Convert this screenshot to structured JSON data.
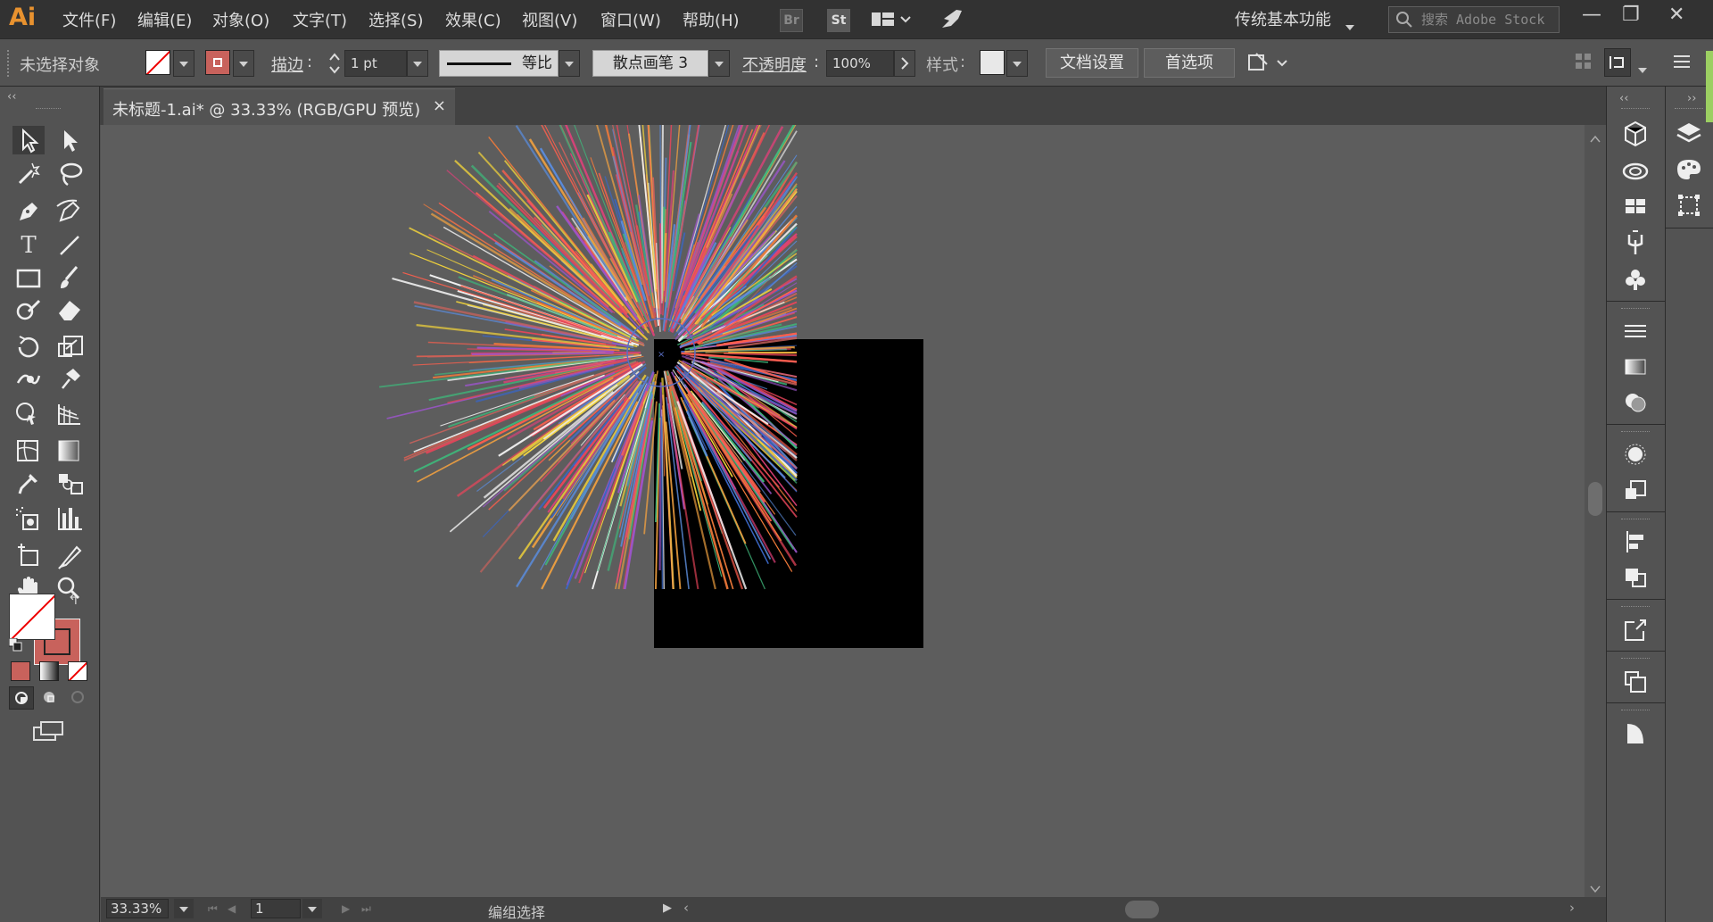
{
  "app": {
    "logo": "Ai"
  },
  "menu": [
    "文件(F)",
    "编辑(E)",
    "对象(O)",
    "文字(T)",
    "选择(S)",
    "效果(C)",
    "视图(V)",
    "窗口(W)",
    "帮助(H)"
  ],
  "bridge_labels": {
    "br": "Br",
    "st": "St"
  },
  "workspace": {
    "label": "传统基本功能"
  },
  "search": {
    "placeholder": "搜索 Adobe Stock"
  },
  "window_controls": {
    "minimize": "—",
    "restore": "❐",
    "close": "✕"
  },
  "control_bar": {
    "selection_status": "未选择对象",
    "stroke_label": "描边",
    "stroke_weight": "1 pt",
    "profile_label": "等比",
    "brush_label": "散点画笔 3",
    "opacity_label": "不透明度",
    "opacity_value": "100%",
    "style_label": "样式",
    "doc_setup_button": "文档设置",
    "preferences_button": "首选项"
  },
  "document_tab": {
    "title": "未标题-1.ai* @ 33.33% (RGB/GPU 预览)",
    "close": "×"
  },
  "status_bar": {
    "zoom": "33.33%",
    "artboard_number": "1",
    "status_text": "编组选择"
  },
  "colors": {
    "fill": "#ffffff",
    "stroke": "#c8625c",
    "artboard": "#000000",
    "canvas": "#5d5d5d",
    "accent": "#e8922f"
  },
  "tool_icons": [
    "selection-tool-icon",
    "direct-selection-tool-icon",
    "magic-wand-icon",
    "lasso-icon",
    "pen-tool-icon",
    "curvature-tool-icon",
    "type-tool-icon",
    "line-tool-icon",
    "rectangle-tool-icon",
    "paintbrush-icon",
    "shaper-icon",
    "eraser-icon",
    "rotate-icon",
    "scale-icon",
    "warp-icon",
    "puppet-warp-icon",
    "shape-builder-icon",
    "perspective-grid-icon",
    "mesh-icon",
    "gradient-icon",
    "eyedropper-icon",
    "blend-icon",
    "symbol-sprayer-icon",
    "column-graph-icon",
    "artboard-tool-icon",
    "slice-tool-icon",
    "hand-icon",
    "zoom-icon"
  ]
}
